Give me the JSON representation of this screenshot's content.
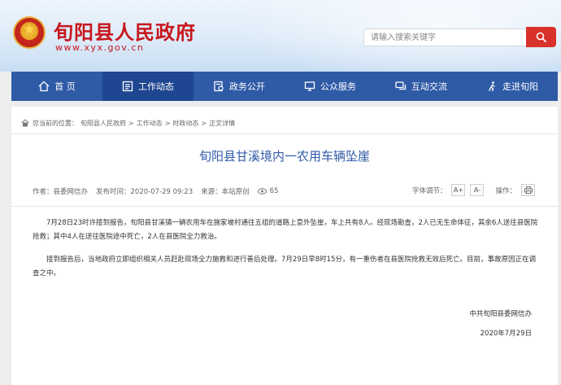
{
  "header": {
    "site_title": "旬阳县人民政府",
    "site_url": "www.xyx.gov.cn",
    "search_placeholder": "请输入搜索关键字",
    "emblem_icon": "national-emblem",
    "search_icon": "search-icon"
  },
  "nav": {
    "items": [
      {
        "label": "首 页",
        "icon": "home-icon"
      },
      {
        "label": "工作动态",
        "icon": "news-icon",
        "active": true
      },
      {
        "label": "政务公开",
        "icon": "document-icon"
      },
      {
        "label": "公众服务",
        "icon": "monitor-icon"
      },
      {
        "label": "互动交流",
        "icon": "chat-icon"
      },
      {
        "label": "走进旬阳",
        "icon": "walk-icon"
      }
    ]
  },
  "breadcrumb": {
    "prefix": "您当前的位置：",
    "items": [
      "旬阳县人民政府",
      "工作动态",
      "时政动态",
      "正文详情"
    ],
    "separator": ">"
  },
  "article": {
    "title": "旬阳县甘溪境内一农用车辆坠崖",
    "author": "作者：县委网信办",
    "publish_time": "发布时间：2020-07-29 09:23",
    "source": "来源：本站原创",
    "views": "65",
    "font_size_label": "字体调节：",
    "font_increase": "A+",
    "font_decrease": "A-",
    "operations_label": "操作：",
    "paragraphs": [
      "7月28日23时许接到报告，旬阳县甘溪镇一辆农用车在施家坡村通往五组的道路上意外坠崖，车上共有8人。经现场勘查，2人已无生命体征，其余6人送往县医院抢救；其中4人在送往医院途中死亡，2人在县医院全力救治。",
      "接到报告后，当地政府立即组织相关人员赶赴现场全力施救和进行善后处理。7月29日早8时15分，有一重伤者在县医院抢救无效后死亡。目前，事故原因正在调查之中。"
    ],
    "signature_org": "中共旬阳县委网信办",
    "signature_date": "2020年7月29日"
  },
  "colors": {
    "brand_red": "#c8161d",
    "nav_blue": "#2f5aa6",
    "title_blue": "#2f5aa6"
  }
}
